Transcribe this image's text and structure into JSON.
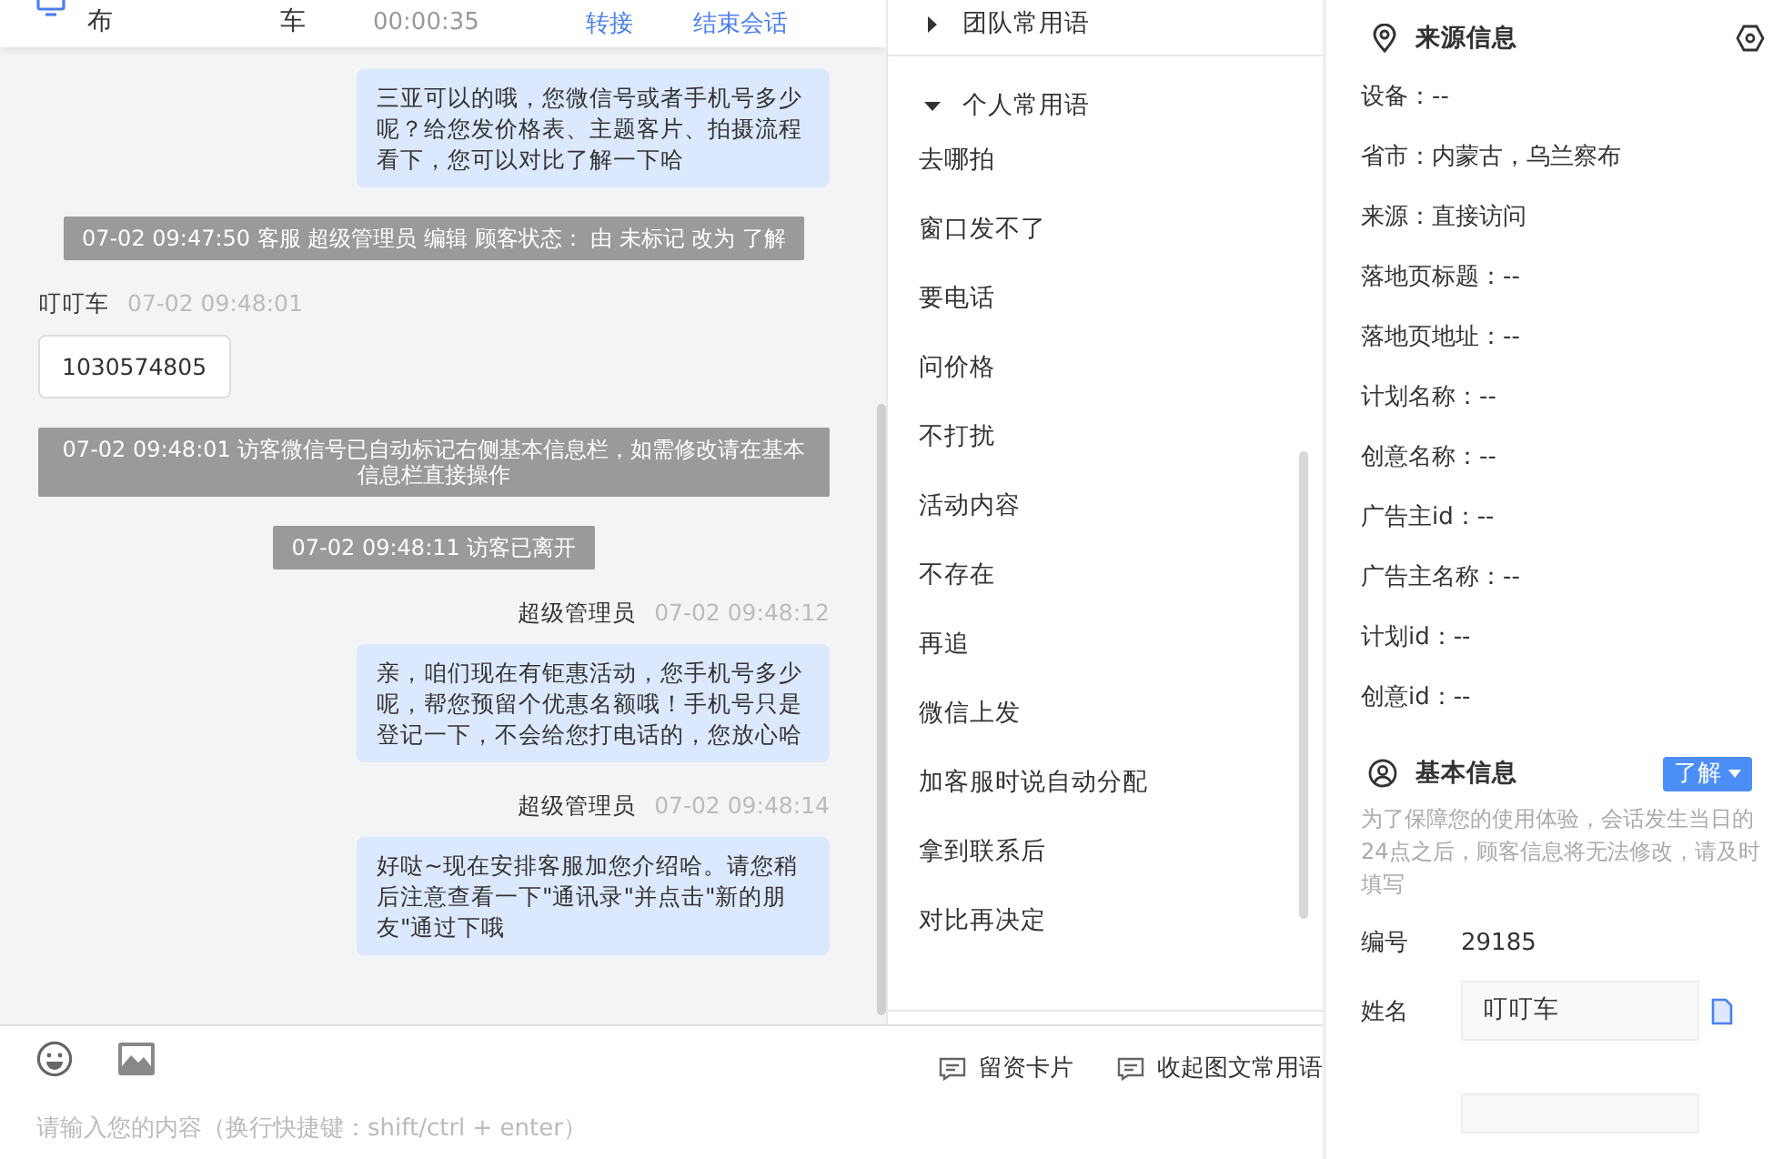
{
  "header": {
    "visitor_col": "布",
    "name_col": "车",
    "duration": "00:00:35",
    "actions": [
      "转接",
      "结束会话"
    ]
  },
  "messages": [
    {
      "kind": "agent",
      "text": "三亚可以的哦，您微信号或者手机号多少呢？给您发价格表、主题客片、拍摄流程看下，您可以对比了解一下哈"
    },
    {
      "kind": "system",
      "text": "07-02 09:47:50 客服 超级管理员 编辑 顾客状态： 由 未标记 改为 了解"
    },
    {
      "kind": "visitor",
      "sender": "叮叮车",
      "time": "07-02 09:48:01",
      "text": "1030574805"
    },
    {
      "kind": "system",
      "text": "07-02 09:48:01 访客微信号已自动标记右侧基本信息栏，如需修改请在基本信息栏直接操作"
    },
    {
      "kind": "system",
      "text": "07-02 09:48:11 访客已离开"
    },
    {
      "kind": "agent",
      "sender": "超级管理员",
      "time": "07-02 09:48:12",
      "text": "亲，咱们现在有钜惠活动，您手机号多少呢，帮您预留个优惠名额哦！手机号只是登记一下，不会给您打电话的，您放心哈"
    },
    {
      "kind": "agent",
      "sender": "超级管理员",
      "time": "07-02 09:48:14",
      "text": "好哒~现在安排客服加您介绍哈。请您稍后注意查看一下\"通讯录\"并点击\"新的朋友\"通过下哦"
    }
  ],
  "composer": {
    "placeholder": "请输入您的内容（换行快捷键：shift/ctrl + enter）"
  },
  "phrases": {
    "groups": [
      {
        "title": "团队常用语",
        "expanded": false
      },
      {
        "title": "个人常用语",
        "expanded": true,
        "items": [
          "去哪拍",
          "窗口发不了",
          "要电话",
          "问价格",
          "不打扰",
          "活动内容",
          "不存在",
          "再追",
          "微信上发",
          "加客服时说自动分配",
          "拿到联系后",
          "对比再决定"
        ]
      }
    ],
    "tools": [
      "留资卡片",
      "收起图文常用语"
    ]
  },
  "source_info": {
    "title": "来源信息",
    "rows": [
      "设备：--",
      "省市：内蒙古，乌兰察布",
      "来源：直接访问",
      "落地页标题：--",
      "落地页地址：--",
      "计划名称：--",
      "创意名称：--",
      "广告主id：--",
      "广告主名称：--",
      "计划id：--",
      "创意id：--"
    ]
  },
  "basic_info": {
    "title": "基本信息",
    "status": "了解",
    "note": "为了保障您的使用体验，会话发生当日的24点之后，顾客信息将无法修改，请及时填写",
    "id_label": "编号",
    "id_value": "29185",
    "name_label": "姓名",
    "name_value": "叮叮车"
  }
}
